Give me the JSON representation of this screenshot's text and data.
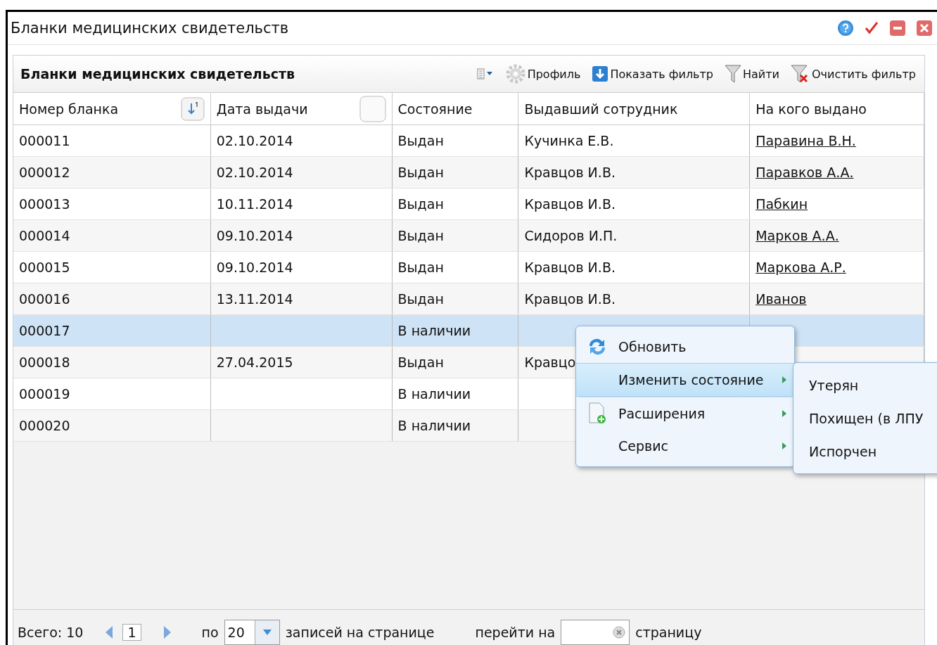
{
  "window": {
    "title": "Бланки медицинских свидетельств"
  },
  "panel": {
    "title": "Бланки медицинских свидетельств",
    "toolbar": [
      {
        "kind": "columns"
      },
      {
        "kind": "gear",
        "label": "Профиль"
      },
      {
        "kind": "show-filter",
        "label": "Показать фильтр"
      },
      {
        "kind": "funnel",
        "label": "Найти"
      },
      {
        "kind": "funnel-clear",
        "label": "Очистить фильтр"
      }
    ]
  },
  "table": {
    "columns": [
      "Номер бланка",
      "Дата выдачи",
      "Состояние",
      "Выдавший сотрудник",
      "На кого выдано"
    ],
    "rows": [
      {
        "number": "000011",
        "date": "02.10.2014",
        "status": "Выдан",
        "employee": "Кучинка Е.В.",
        "recipient": "Паравина В.Н.",
        "selected": false
      },
      {
        "number": "000012",
        "date": "02.10.2014",
        "status": "Выдан",
        "employee": "Кравцов И.В.",
        "recipient": "Паравков А.А.",
        "selected": false
      },
      {
        "number": "000013",
        "date": "10.11.2014",
        "status": "Выдан",
        "employee": "Кравцов И.В.",
        "recipient": "Пабкин",
        "selected": false
      },
      {
        "number": "000014",
        "date": "09.10.2014",
        "status": "Выдан",
        "employee": "Сидоров И.П.",
        "recipient": "Марков А.А.",
        "selected": false
      },
      {
        "number": "000015",
        "date": "09.10.2014",
        "status": "Выдан",
        "employee": "Кравцов И.В.",
        "recipient": "Маркова А.Р.",
        "selected": false
      },
      {
        "number": "000016",
        "date": "13.11.2014",
        "status": "Выдан",
        "employee": "Кравцов И.В.",
        "recipient": "Иванов",
        "selected": false
      },
      {
        "number": "000017",
        "status": "В наличии",
        "selected": true
      },
      {
        "number": "000018",
        "date": "27.04.2015",
        "status": "Выдан",
        "employee": "Кравцо",
        "selected": false
      },
      {
        "number": "000019",
        "status": "В наличии",
        "selected": false
      },
      {
        "number": "000020",
        "status": "В наличии",
        "selected": false
      }
    ]
  },
  "context_menu": {
    "items": [
      {
        "label": "Обновить",
        "kind": "refresh",
        "submenu": false,
        "selected": false
      },
      {
        "label": "Изменить состояние",
        "kind": "plain",
        "submenu": true,
        "selected": true
      },
      {
        "label": "Расширения",
        "kind": "add-doc",
        "submenu": true,
        "selected": false
      },
      {
        "label": "Сервис",
        "kind": "plain",
        "submenu": true,
        "selected": false
      }
    ],
    "submenu": [
      "Утерян",
      "Похищен (в ЛПУ",
      "Испорчен"
    ]
  },
  "footer": {
    "total": "Всего: 10",
    "page": "1",
    "per_page_prefix": "по",
    "per_page": "20",
    "per_page_suffix": "записей на странице",
    "goto_prefix": "перейти на",
    "goto_suffix": "страницу"
  }
}
